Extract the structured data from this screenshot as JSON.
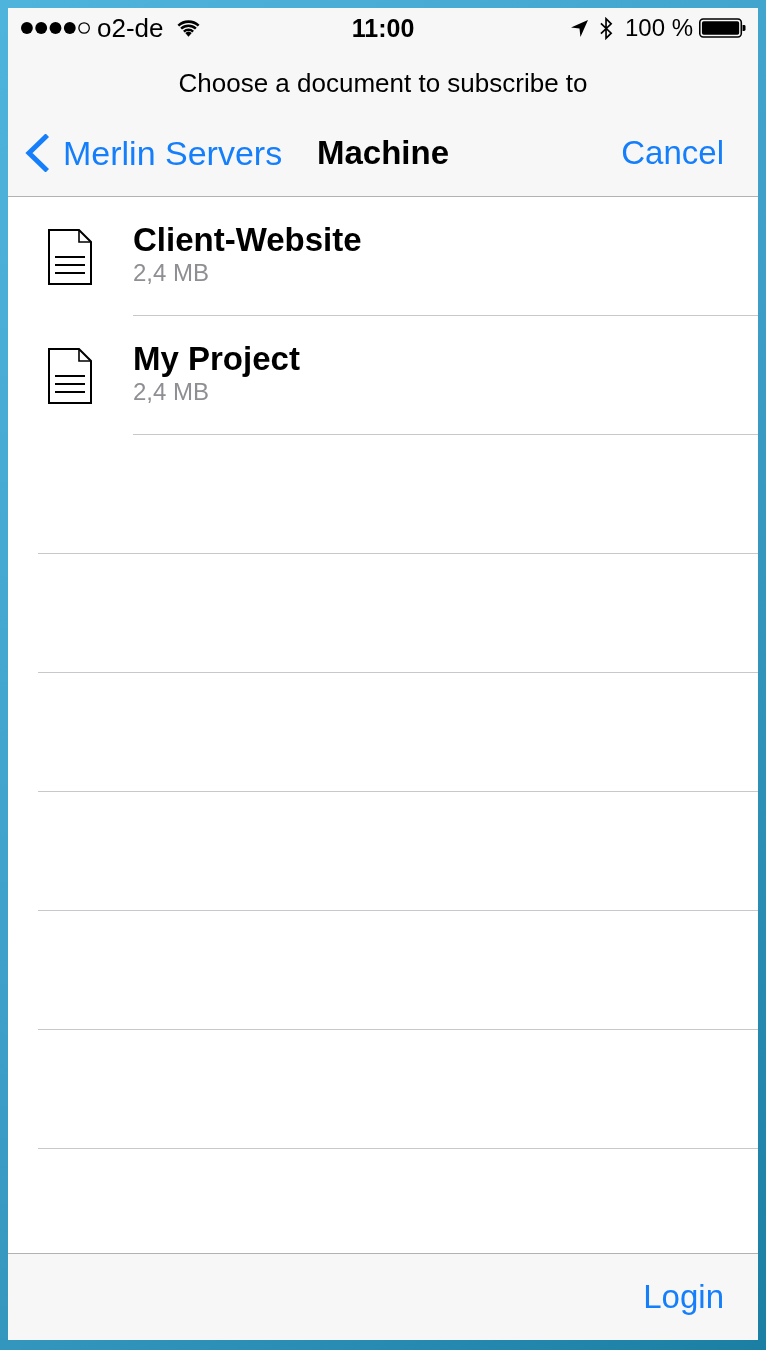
{
  "status_bar": {
    "carrier": "o2-de",
    "time": "11:00",
    "battery": "100 %"
  },
  "prompt": "Choose a document to subscribe to",
  "nav_bar": {
    "back": "Merlin Servers",
    "title": "Machine",
    "cancel": "Cancel"
  },
  "documents": [
    {
      "name": "Client-Website",
      "size": "2,4 MB"
    },
    {
      "name": "My Project",
      "size": "2,4 MB"
    }
  ],
  "toolbar": {
    "login": "Login"
  }
}
